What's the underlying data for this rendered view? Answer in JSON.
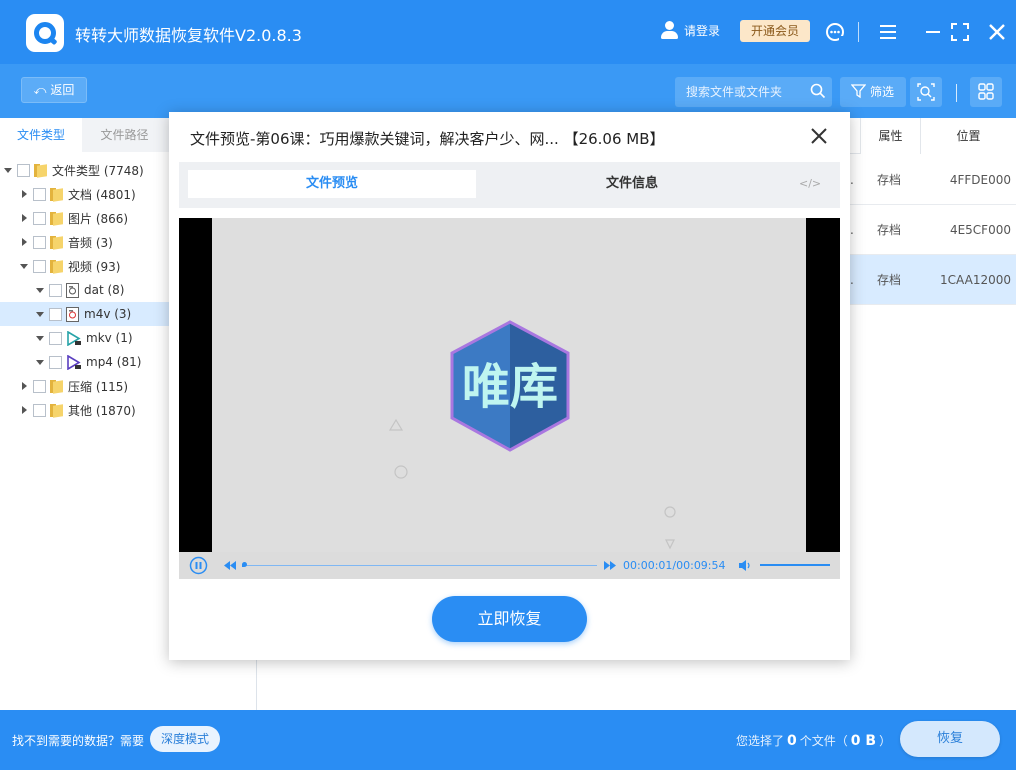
{
  "app": {
    "title": "转转大师数据恢复软件V2.0.8.3",
    "login_label": "请登录",
    "vip_label": "开通会员"
  },
  "toolbar": {
    "back_label": "返回",
    "search_placeholder": "搜索文件或文件夹",
    "filter_label": "筛选"
  },
  "left_panel": {
    "tabs": [
      "文件类型",
      "文件路径"
    ],
    "tree": [
      {
        "label": "文件类型 (7748)",
        "level": 0,
        "expanded": true,
        "icon": "folder-icon"
      },
      {
        "label": "文档 (4801)",
        "level": 1,
        "expanded": false,
        "icon": "folder-icon"
      },
      {
        "label": "图片 (866)",
        "level": 1,
        "expanded": false,
        "icon": "folder-icon"
      },
      {
        "label": "音频 (3)",
        "level": 1,
        "expanded": false,
        "icon": "folder-icon"
      },
      {
        "label": "视频 (93)",
        "level": 1,
        "expanded": true,
        "icon": "folder-icon"
      },
      {
        "label": "dat (8)",
        "level": 2,
        "expanded": true,
        "icon": "dat-file-icon"
      },
      {
        "label": "m4v (3)",
        "level": 2,
        "expanded": true,
        "icon": "m4v-file-icon",
        "selected": true
      },
      {
        "label": "mkv (1)",
        "level": 2,
        "expanded": true,
        "icon": "mkv-play-icon"
      },
      {
        "label": "mp4 (81)",
        "level": 2,
        "expanded": true,
        "icon": "mp4-play-icon"
      },
      {
        "label": "压缩 (115)",
        "level": 1,
        "expanded": false,
        "icon": "folder-icon"
      },
      {
        "label": "其他 (1870)",
        "level": 1,
        "expanded": false,
        "icon": "folder-icon"
      }
    ]
  },
  "table": {
    "columns": {
      "attr": "属性",
      "location": "位置"
    },
    "rows": [
      {
        "dot": ".",
        "attr": "存档",
        "location": "4FFDE000"
      },
      {
        "dot": ".",
        "attr": "存档",
        "location": "4E5CF000"
      },
      {
        "dot": ".",
        "attr": "存档",
        "location": "1CAA12000",
        "selected": true
      }
    ]
  },
  "modal": {
    "title": "文件预览-第06课：巧用爆款关键词，解决客户少、网...  【26.06 MB】",
    "tabs": [
      "文件预览",
      "文件信息"
    ],
    "code_label": "</>",
    "watermark_text": "唯库",
    "time": "00:00:01/00:09:54",
    "progress": 0.0017,
    "volume": 1.0,
    "recover_label": "立即恢复"
  },
  "bottom": {
    "hint": "找不到需要的数据？需要",
    "deep_mode_label": "深度模式",
    "sel_prefix": "您选择了",
    "sel_count": "0",
    "sel_mid": "个文件（",
    "sel_size": "0 B",
    "sel_suffix": "）",
    "recover_label": "恢复"
  },
  "colors": {
    "primary": "#2a8df3",
    "toolbar": "#3a99f5",
    "selected_row": "#d8ebff"
  }
}
